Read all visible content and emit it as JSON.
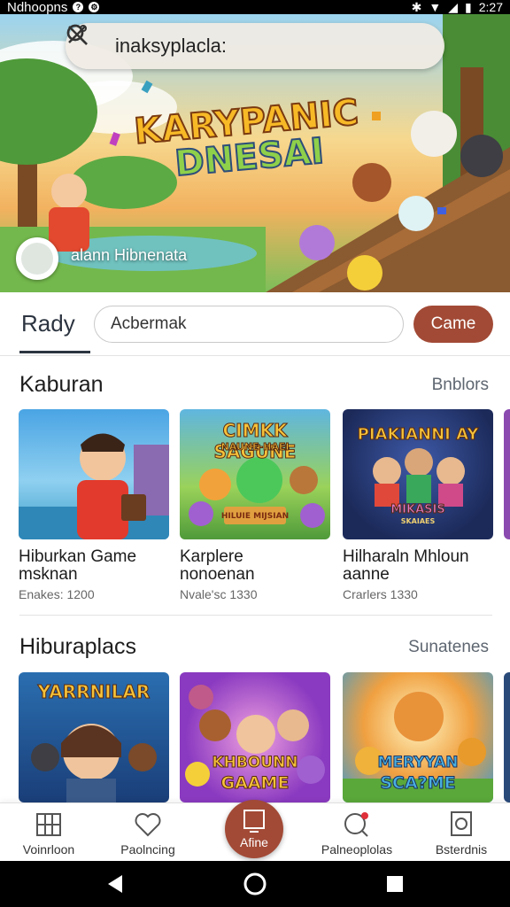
{
  "status_bar": {
    "carrier": "Ndhoopns",
    "time": "2:27"
  },
  "hero": {
    "search_text": "inaksyplacla:",
    "title_line1": "KARYPANIC",
    "title_line2": "DNESAI",
    "caption": "alann Hibnenata"
  },
  "tabs": {
    "active_label": "Rady",
    "input_value": "Acbermak",
    "button_label": "Came"
  },
  "section1": {
    "title": "Kaburan",
    "link": "Bnblors",
    "cards": [
      {
        "title1": "Hiburkan Game",
        "title2": "msknan",
        "meta": "Enakes: 1200"
      },
      {
        "title1": "Karplere",
        "title2": "nonoenan",
        "meta": "Nvale'sc 1330",
        "art_line1": "CIMKK SAGUNE",
        "art_line2": "NAUNE-HAEI",
        "art_line3": "HILUIE MIJSIAN"
      },
      {
        "title1": "Hilharaln Mhloun",
        "title2": "aanne",
        "meta": "Crarlers 1330",
        "art_line1": "PIAKIANNI AY",
        "art_line2": "MIKASIS",
        "art_line3": "SKAIAES"
      }
    ]
  },
  "section2": {
    "title": "Hiburaplacs",
    "link": "Sunatenes",
    "cards": [
      {
        "art_line1": "YARRNILAR"
      },
      {
        "art_line1": "KHBOUNN",
        "art_line2": "GAAME"
      },
      {
        "art_line1": "MERYYAN",
        "art_line2": "SCA?ME"
      }
    ]
  },
  "bottom_nav": {
    "items": [
      {
        "label": "Voinrloon",
        "icon": "grid-icon"
      },
      {
        "label": "Paolncing",
        "icon": "heart-icon"
      },
      {
        "label": "Afine",
        "icon": "tablet-icon"
      },
      {
        "label": "Palneoplolas",
        "icon": "search-notification-icon"
      },
      {
        "label": "Bsterdnis",
        "icon": "clock-icon"
      }
    ]
  },
  "colors": {
    "accent": "#a24a36",
    "tab_text": "#2c3440"
  }
}
